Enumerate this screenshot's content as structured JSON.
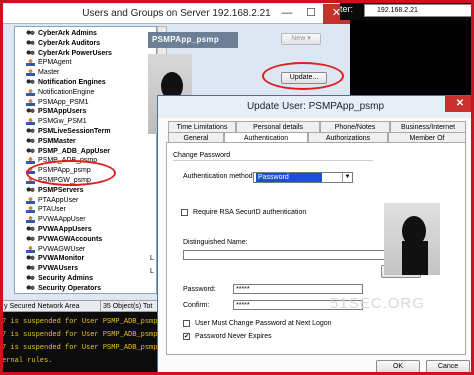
{
  "outer_window": {
    "title": "Users and Groups on Server 192.168.2.21",
    "minimize": "—",
    "maximize": "☐",
    "close": "✕"
  },
  "tree_items": [
    {
      "label": "CyberArk Admins",
      "bold": true,
      "icon": "group-icon"
    },
    {
      "label": "CyberArk Auditors",
      "bold": true,
      "icon": "group-icon"
    },
    {
      "label": "CyberArk PowerUsers",
      "bold": true,
      "icon": "group-icon"
    },
    {
      "label": "EPMAgent",
      "bold": false,
      "icon": "user-icon"
    },
    {
      "label": "Master",
      "bold": false,
      "icon": "user-icon"
    },
    {
      "label": "Notification Engines",
      "bold": true,
      "icon": "group-icon"
    },
    {
      "label": "NotificationEngine",
      "bold": false,
      "icon": "user-icon"
    },
    {
      "label": "PSMApp_PSM1",
      "bold": false,
      "icon": "user-icon"
    },
    {
      "label": "PSMAppUsers",
      "bold": true,
      "icon": "group-icon"
    },
    {
      "label": "PSMGw_PSM1",
      "bold": false,
      "icon": "user-icon"
    },
    {
      "label": "PSMLiveSessionTerm",
      "bold": true,
      "icon": "group-icon"
    },
    {
      "label": "PSMMaster",
      "bold": true,
      "icon": "group-icon"
    },
    {
      "label": "PSMP_ADB_AppUser",
      "bold": true,
      "icon": "group-icon"
    },
    {
      "label": "PSMP_ADB_psmp",
      "bold": false,
      "icon": "user-icon"
    },
    {
      "label": "PSMPApp_psmp",
      "bold": false,
      "icon": "user-icon"
    },
    {
      "label": "PSMPGW_psmp",
      "bold": false,
      "icon": "user-icon"
    },
    {
      "label": "PSMPServers",
      "bold": true,
      "icon": "group-icon"
    },
    {
      "label": "PTAAppUser",
      "bold": false,
      "icon": "user-icon"
    },
    {
      "label": "PTAUser",
      "bold": false,
      "icon": "user-icon"
    },
    {
      "label": "PVWAAppUser",
      "bold": false,
      "icon": "user-icon"
    },
    {
      "label": "PVWAAppUsers",
      "bold": true,
      "icon": "group-icon"
    },
    {
      "label": "PVWAGWAccounts",
      "bold": true,
      "icon": "group-icon"
    },
    {
      "label": "PVWAGWUser",
      "bold": false,
      "icon": "user-icon"
    },
    {
      "label": "PVWAMonitor",
      "bold": true,
      "icon": "group-icon"
    },
    {
      "label": "PVWAUsers",
      "bold": true,
      "icon": "group-icon"
    },
    {
      "label": "Security Admins",
      "bold": true,
      "icon": "group-icon"
    },
    {
      "label": "Security Operators",
      "bold": true,
      "icon": "group-icon"
    }
  ],
  "right_panel": {
    "selected_name": "PSMPApp_psmp",
    "new_button": "New",
    "update_button": "Update...",
    "l_label": "L"
  },
  "status_bar": {
    "area": "y Secured Network Area",
    "count": "35 Object(s) Tot"
  },
  "log_lines": [
    "7 is suspended for User PSMP_ADB_psmp.",
    "7 is suspended for User PSMP_ADB_psmp.",
    "7 is suspended for User PSMP_ADB_psmp.",
    "ernal rules."
  ],
  "address_bar": {
    "label": "ter:",
    "value": "192.168.2.21"
  },
  "dialog": {
    "title": "Update User: PSMPApp_psmp",
    "close": "✕",
    "tabs_back": [
      "Time Limitations",
      "Personal details",
      "Phone/Notes",
      "Business/Internet"
    ],
    "tabs_front": [
      "General",
      "Authentication",
      "Authorizations",
      "Member Of"
    ],
    "selected_tab": "Authentication",
    "section_title": "Change Password",
    "auth_method_label": "Authentication method:",
    "auth_method_value": "Password",
    "rsa_label": "Require RSA SecurID authentication",
    "dn_label": "Distinguished Name:",
    "select_button": "Select",
    "password_label": "Password:",
    "password_value": "*****",
    "confirm_label": "Confirm:",
    "confirm_value": "*****",
    "must_change_label": "User Must Change Password at Next Logon",
    "never_expires_label": "Password Never Expires",
    "never_expires_checked": "✔",
    "ok_button": "OK",
    "cancel_button": "Cance"
  },
  "watermark": "51SEC.ORG",
  "colors": {
    "highlight": "#e01e1e",
    "selection": "#1c4fd4",
    "log_text": "#e8c420",
    "frame": "#c8141e"
  }
}
